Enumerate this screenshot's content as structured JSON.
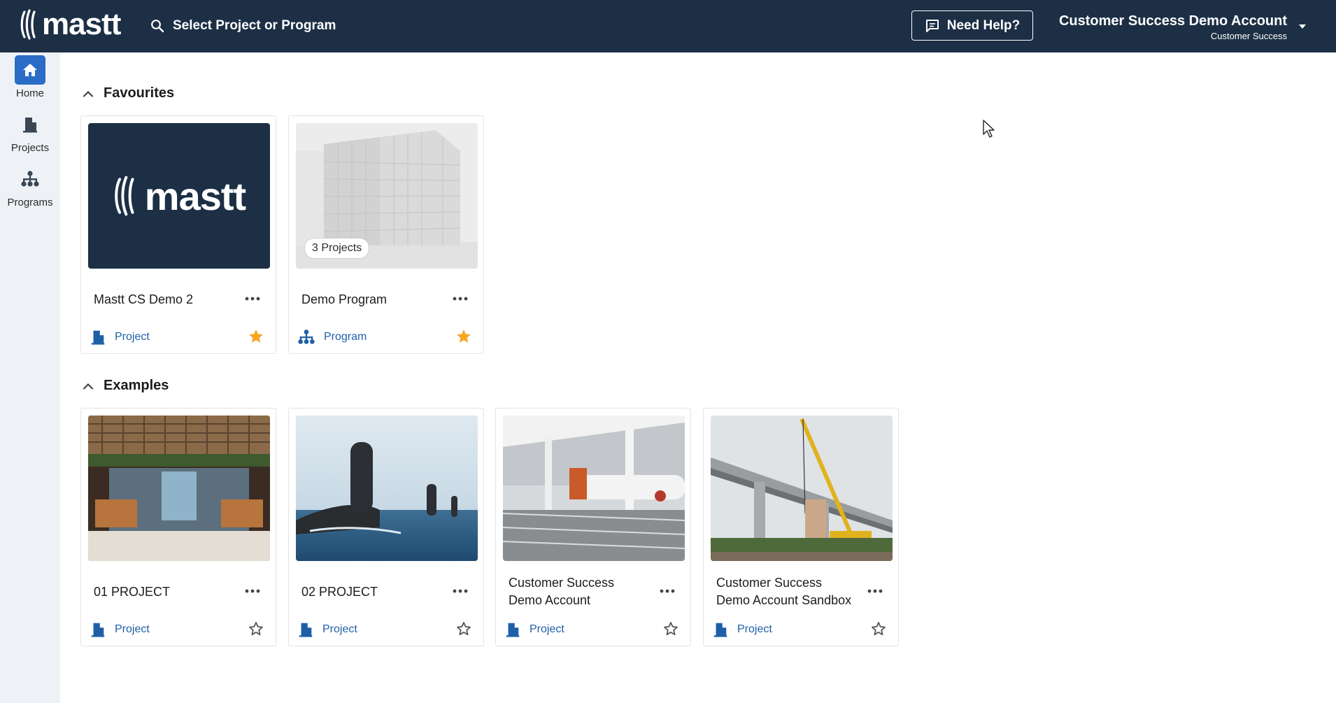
{
  "header": {
    "logo_text": "mastt",
    "search_placeholder": "Select Project or Program",
    "help_label": "Need Help?",
    "account_name": "Customer Success Demo Account",
    "account_role": "Customer Success"
  },
  "sidebar": {
    "items": [
      {
        "label": "Home",
        "icon": "home-icon",
        "active": true
      },
      {
        "label": "Projects",
        "icon": "building-icon",
        "active": false
      },
      {
        "label": "Programs",
        "icon": "hierarchy-icon",
        "active": false
      }
    ]
  },
  "sections": {
    "favourites": {
      "title": "Favourites",
      "cards": [
        {
          "title": "Mastt CS Demo 2",
          "type": "Project",
          "starred": true,
          "thumb_text": "mastt"
        },
        {
          "title": "Demo Program",
          "type": "Program",
          "starred": true,
          "badge": "3 Projects"
        }
      ]
    },
    "examples": {
      "title": "Examples",
      "cards": [
        {
          "title": "01 PROJECT",
          "type": "Project",
          "starred": false
        },
        {
          "title": "02 PROJECT",
          "type": "Project",
          "starred": false
        },
        {
          "title": "Customer Success Demo Account",
          "type": "Project",
          "starred": false
        },
        {
          "title": "Customer Success Demo Account Sandbox",
          "type": "Project",
          "starred": false
        }
      ]
    }
  },
  "colors": {
    "topbar": "#1c2f45",
    "accent": "#2a6cc6",
    "link": "#1f5fa8",
    "star": "#f5a623"
  }
}
